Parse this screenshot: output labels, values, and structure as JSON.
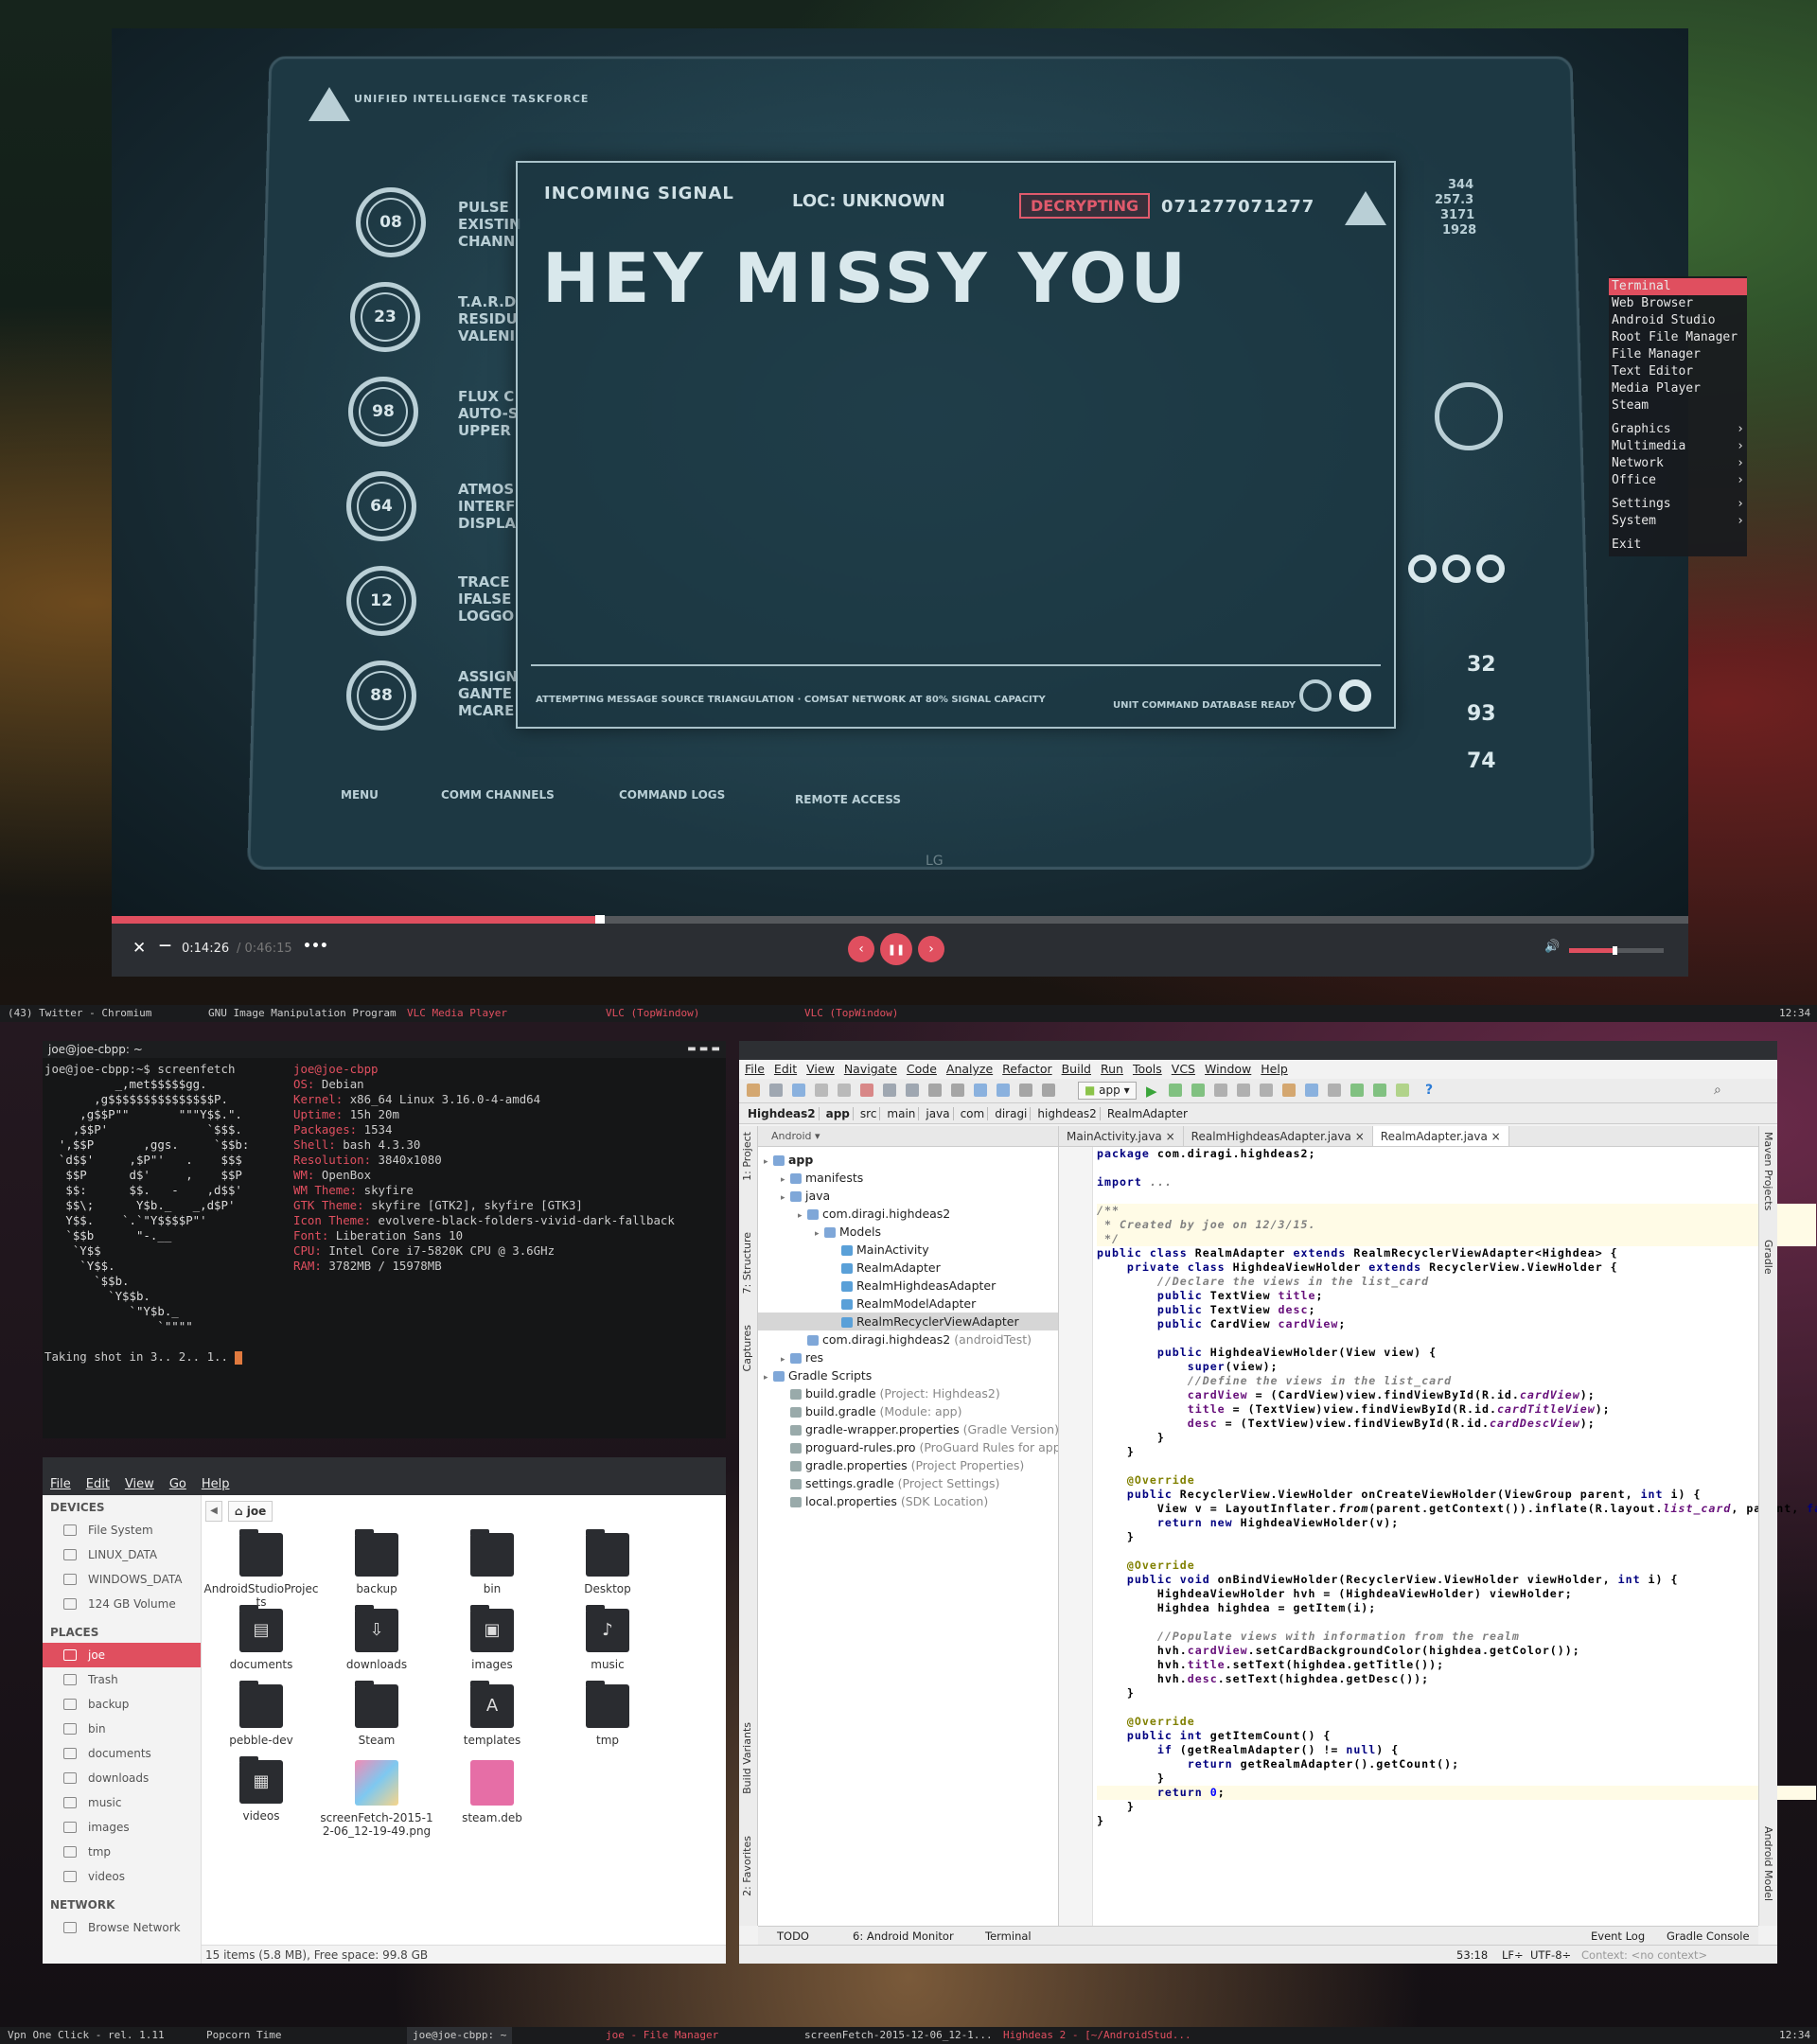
{
  "vlc": {
    "video": {
      "header": "UNIFIED INTELLIGENCE TASKFORCE",
      "incoming": "INCOMING SIGNAL",
      "loc": "LOC: UNKNOWN",
      "decrypting": "DECRYPTING",
      "code": "071277071277",
      "message": "HEY MISSY YOU",
      "attempt": "ATTEMPTING MESSAGE SOURCE TRIANGULATION · COMSAT NETWORK AT 80% SIGNAL CAPACITY",
      "unitcmd": "UNIT COMMAND DATABASE READY",
      "dials": [
        "08",
        "23",
        "98",
        "64",
        "12",
        "88"
      ],
      "side_labels": [
        "PULSE\nEXISTIN\nCHANN",
        "T.A.R.D\nRESIDU\nVALENI",
        "FLUX C\nAUTO-S\nUPPER",
        "ATMOS\nINTERF\nDISPLA",
        "TRACE\nIFALSE\nLOGGO",
        "ASSIGN\nGANTE\nMCARE"
      ],
      "menu": [
        "MENU",
        "COMM CHANNELS",
        "COMMAND LOGS",
        "REMOTE ACCESS"
      ],
      "right_nums": [
        "32",
        "93",
        "74"
      ],
      "right_readout": [
        "344",
        "257.3",
        "3171",
        "1928"
      ],
      "brand": "LG"
    },
    "progress": 0.31,
    "volume": 0.46,
    "elapsed": "0:14:26",
    "total": "/ 0:46:15",
    "close_glyph": "✕",
    "minimize_glyph": "—",
    "more_glyph": "•••",
    "prev_glyph": "‹",
    "pause_glyph": "❚❚",
    "next_glyph": "›",
    "volume_glyph": "🔊"
  },
  "obmenu": {
    "items": [
      "Terminal",
      "Web Browser",
      "Android Studio",
      "Root File Manager",
      "File Manager",
      "Text Editor",
      "Media Player",
      "Steam"
    ],
    "submenus": [
      "Graphics",
      "Multimedia",
      "Network",
      "Office"
    ],
    "system": [
      "Settings",
      "System"
    ],
    "exit": "Exit"
  },
  "top_panel": {
    "tasks": [
      "(43) Twitter - Chromium",
      "GNU Image Manipulation Program",
      "VLC Media Player",
      "VLC (TopWindow)",
      "VLC (TopWindow)"
    ],
    "clock": "12:34"
  },
  "bottom_panel": {
    "tasks": [
      "Vpn One Click - rel. 1.11",
      "Popcorn Time",
      "joe@joe-cbpp: ~",
      "joe - File Manager",
      "screenFetch-2015-12-06_12-1...",
      "Highdeas 2 - [~/AndroidStud..."
    ],
    "clock": "12:34"
  },
  "terminal": {
    "title": "joe@joe-cbpp: ~",
    "prompt": "joe@joe-cbpp:~$ screenfetch",
    "logo": "          _,met$$$$$gg.\n       ,g$$$$$$$$$$$$$$$P.\n     ,g$$P\"\"       \"\"\"Y$$.\".\n    ,$$P'              `$$$.\n  ',$$P       ,ggs.     `$$b:\n  `d$$'     ,$P\"'   .    $$$\n   $$P      d$'     ,    $$P\n   $$:      $$.   -    ,d$$'\n   $$\\;      Y$b._   _,d$P'\n   Y$$.    `.`\"Y$$$$P\"'\n   `$$b      \"-.__\n    `Y$$\n     `Y$$.\n       `$$b.\n         `Y$$b.\n            `\"Y$b._\n                `\"\"\"\"",
    "user": "joe@joe-cbpp",
    "info": [
      [
        "OS:",
        "Debian"
      ],
      [
        "Kernel:",
        "x86_64 Linux 3.16.0-4-amd64"
      ],
      [
        "Uptime:",
        "15h 20m"
      ],
      [
        "Packages:",
        "1534"
      ],
      [
        "Shell:",
        "bash 4.3.30"
      ],
      [
        "Resolution:",
        "3840x1080"
      ],
      [
        "WM:",
        "OpenBox"
      ],
      [
        "WM Theme:",
        "skyfire"
      ],
      [
        "GTK Theme:",
        "skyfire [GTK2], skyfire [GTK3]"
      ],
      [
        "Icon Theme:",
        "evolvere-black-folders-vivid-dark-fallback"
      ],
      [
        "Font:",
        "Liberation Sans 10"
      ],
      [
        "CPU:",
        "Intel Core i7-5820K CPU @ 3.6GHz"
      ],
      [
        "RAM:",
        "3782MB / 15978MB"
      ]
    ],
    "last": "Taking shot in 3.. 2.. 1.. "
  },
  "filemanager": {
    "menu": [
      "File",
      "Edit",
      "View",
      "Go",
      "Help"
    ],
    "devices_label": "DEVICES",
    "devices": [
      "File System",
      "LINUX_DATA",
      "WINDOWS_DATA",
      "124 GB Volume"
    ],
    "places_label": "PLACES",
    "places": [
      "joe",
      "Trash",
      "backup",
      "bin",
      "documents",
      "downloads",
      "music",
      "images",
      "tmp",
      "videos"
    ],
    "network_label": "NETWORK",
    "network": [
      "Browse Network"
    ],
    "path": "joe",
    "back_glyph": "◀",
    "items": [
      "AndroidStudioProjects",
      "backup",
      "bin",
      "Desktop",
      "documents",
      "downloads",
      "images",
      "music",
      "pebble-dev",
      "Steam",
      "templates",
      "tmp",
      "videos",
      "screenFetch-2015-12-06_12-19-49.png",
      "steam.deb"
    ],
    "status": "15 items (5.8 MB), Free space: 99.8 GB"
  },
  "studio": {
    "menu": [
      "File",
      "Edit",
      "View",
      "Navigate",
      "Code",
      "Analyze",
      "Refactor",
      "Build",
      "Run",
      "Tools",
      "VCS",
      "Window",
      "Help"
    ],
    "run_config": "app",
    "breadcrumbs": [
      "Highdeas2",
      "app",
      "src",
      "main",
      "java",
      "com",
      "diragi",
      "highdeas2",
      "RealmAdapter"
    ],
    "project_view": "Android",
    "left_tabs": [
      "1: Project",
      "7: Structure",
      "Captures",
      "Build Variants",
      "2: Favorites"
    ],
    "right_tabs": [
      "Maven Projects",
      "Gradle",
      "Android Model"
    ],
    "tree": [
      {
        "t": "app",
        "i": 0,
        "bold": true
      },
      {
        "t": "manifests",
        "i": 1
      },
      {
        "t": "java",
        "i": 1
      },
      {
        "t": "com.diragi.highdeas2",
        "i": 2
      },
      {
        "t": "Models",
        "i": 3
      },
      {
        "t": "MainActivity",
        "i": 4
      },
      {
        "t": "RealmAdapter",
        "i": 4
      },
      {
        "t": "RealmHighdeasAdapter",
        "i": 4
      },
      {
        "t": "RealmModelAdapter",
        "i": 4
      },
      {
        "t": "RealmRecyclerViewAdapter",
        "i": 4,
        "sel": true
      },
      {
        "t": "com.diragi.highdeas2",
        "g": "(androidTest)",
        "i": 2
      },
      {
        "t": "res",
        "i": 1
      },
      {
        "t": "Gradle Scripts",
        "i": 0
      },
      {
        "t": "build.gradle",
        "g": "(Project: Highdeas2)",
        "i": 1
      },
      {
        "t": "build.gradle",
        "g": "(Module: app)",
        "i": 1
      },
      {
        "t": "gradle-wrapper.properties",
        "g": "(Gradle Version)",
        "i": 1
      },
      {
        "t": "proguard-rules.pro",
        "g": "(ProGuard Rules for app)",
        "i": 1
      },
      {
        "t": "gradle.properties",
        "g": "(Project Properties)",
        "i": 1
      },
      {
        "t": "settings.gradle",
        "g": "(Project Settings)",
        "i": 1
      },
      {
        "t": "local.properties",
        "g": "(SDK Location)",
        "i": 1
      }
    ],
    "tabs": [
      "MainActivity.java",
      "RealmHighdeasAdapter.java",
      "RealmAdapter.java"
    ],
    "tab_close_glyph": "×",
    "bottom_tools": [
      "TODO",
      "6: Android Monitor",
      "Terminal"
    ],
    "bottom_right": [
      "Event Log",
      "Gradle Console"
    ],
    "status": {
      "pos": "53:18",
      "lf": "LF÷",
      "enc": "UTF-8÷",
      "ctx": "Context: <no context>"
    }
  }
}
